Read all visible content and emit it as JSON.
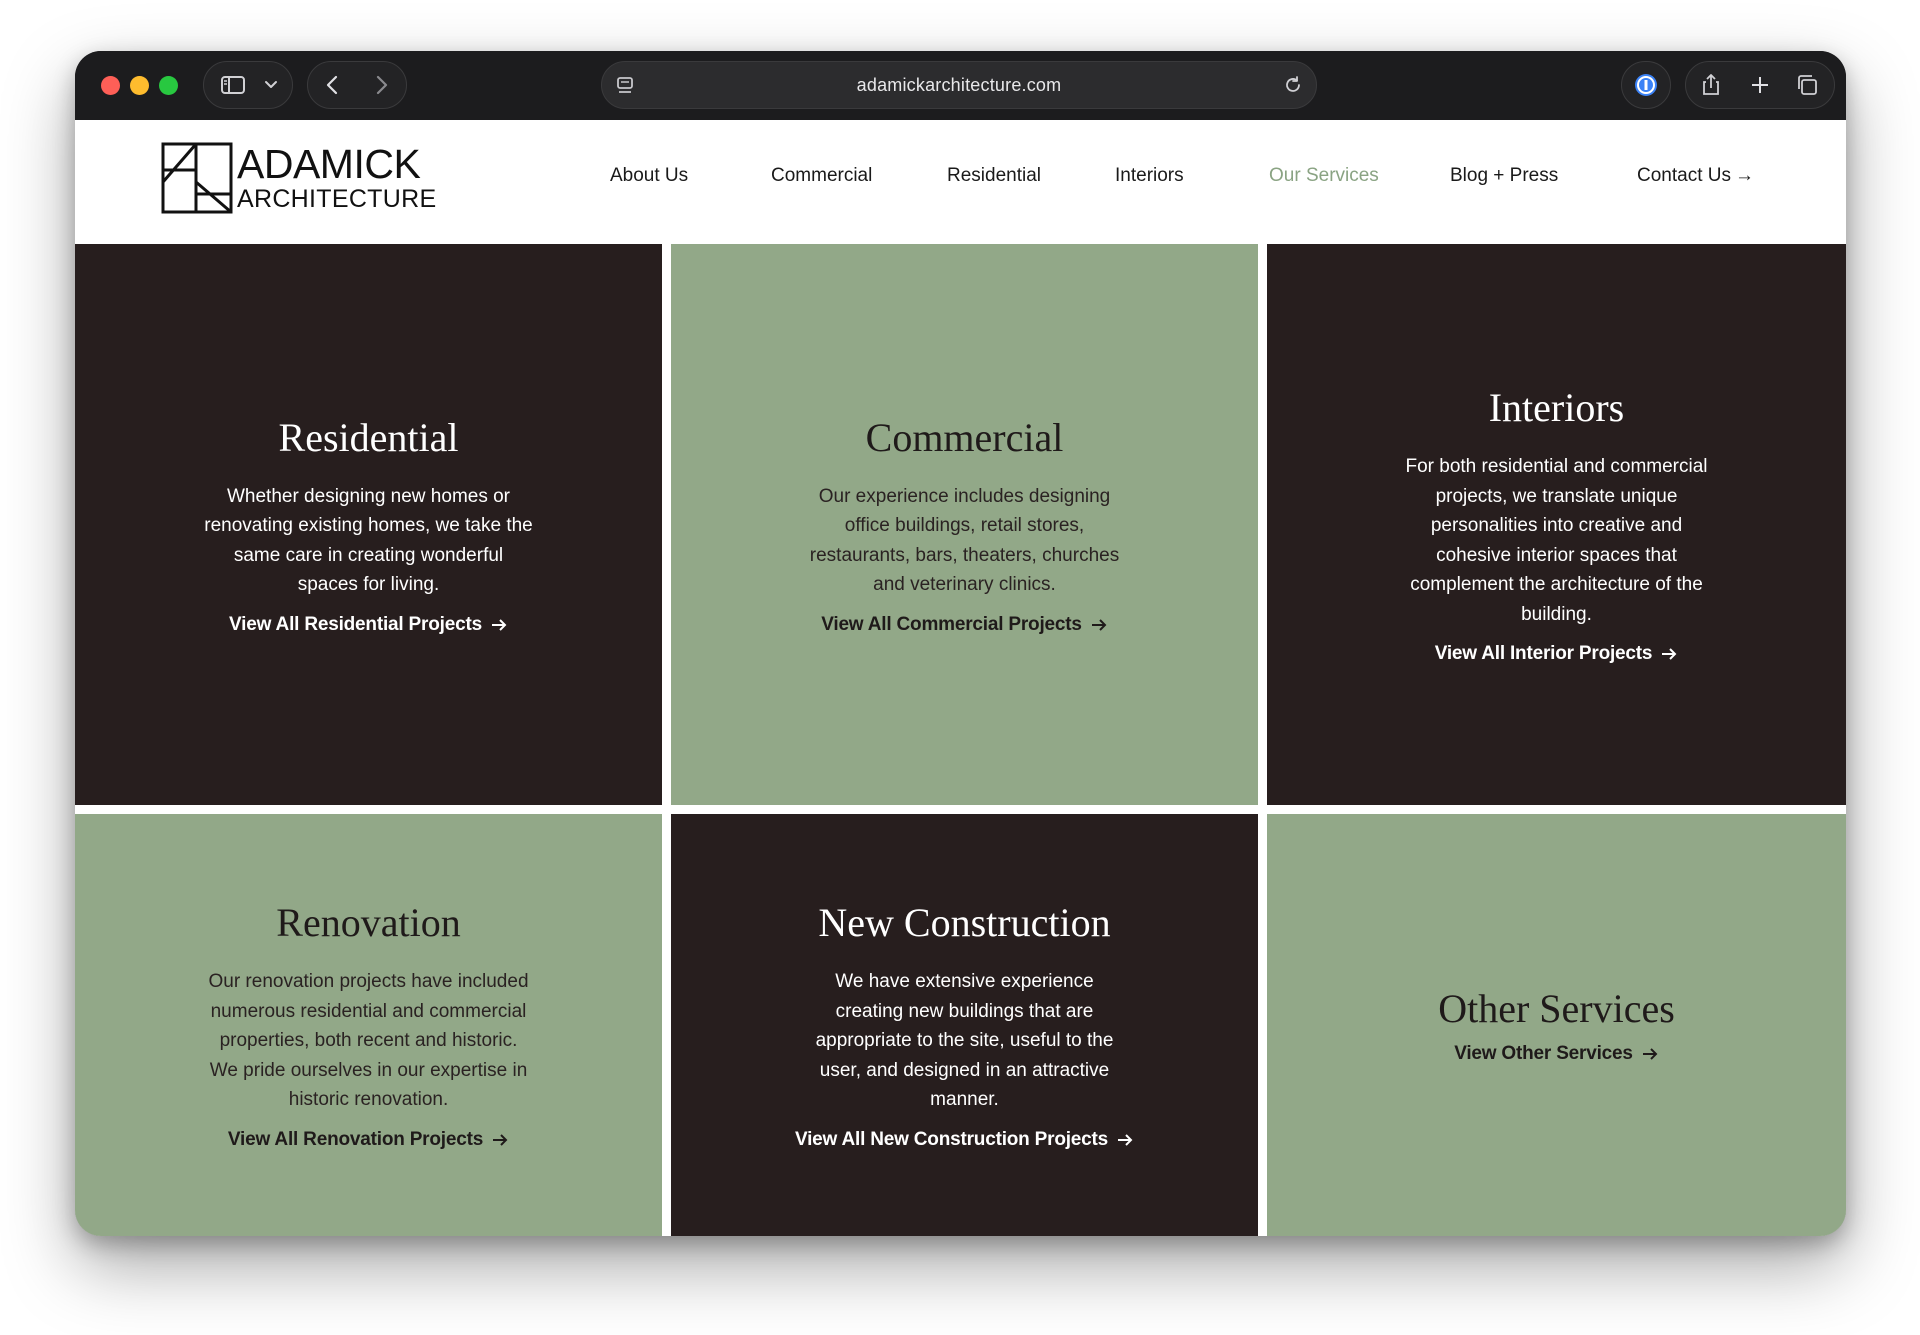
{
  "browser": {
    "url": "adamickarchitecture.com"
  },
  "logo": {
    "line1": "ADAMICK",
    "line2": "ARCHITECTURE"
  },
  "nav": {
    "items": [
      {
        "label": "About Us"
      },
      {
        "label": "Commercial"
      },
      {
        "label": "Residential"
      },
      {
        "label": "Interiors"
      },
      {
        "label": "Our Services"
      },
      {
        "label": "Blog + Press"
      },
      {
        "label": "Contact Us"
      }
    ],
    "active": "Our Services"
  },
  "colors": {
    "dark_tile": "#271e1e",
    "green_tile": "#92a888",
    "active_nav": "#8aa383"
  },
  "services": [
    {
      "title": "Residential",
      "description": "Whether designing new homes or renovating existing homes, we take the same care in creating wonderful spaces for living.",
      "link": "View All Residential Projects"
    },
    {
      "title": "Commercial",
      "description": "Our experience includes designing office buildings, retail stores, restaurants, bars, theaters, churches and veterinary clinics.",
      "link": "View All Commercial Projects"
    },
    {
      "title": "Interiors",
      "description": "For both residential and commercial projects, we translate unique personalities into creative and cohesive interior spaces that complement the architecture of the building.",
      "link": "View All Interior Projects"
    },
    {
      "title": "Renovation",
      "description": "Our renovation projects have included numerous residential and commercial properties, both recent and historic.  We pride ourselves in our expertise in historic renovation.",
      "link": "View All Renovation Projects"
    },
    {
      "title": "New Construction",
      "description": "We have extensive experience creating new buildings that are appropriate to the site, useful to the user, and designed in an attractive manner.",
      "link": "View All New Construction Projects"
    },
    {
      "title": "Other Services",
      "description": "",
      "link": "View Other Services"
    }
  ]
}
